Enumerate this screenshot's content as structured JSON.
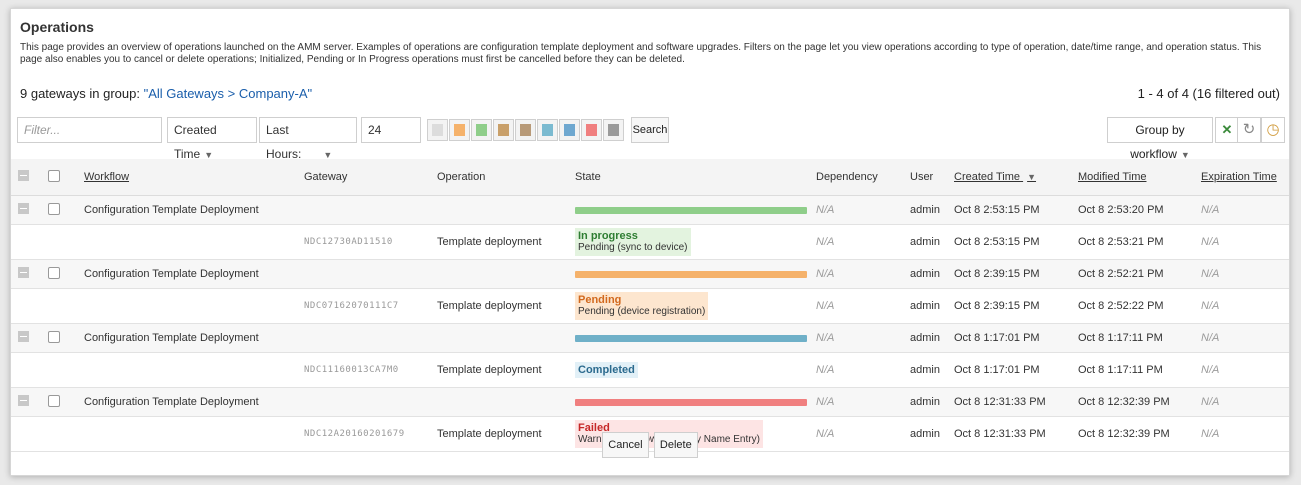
{
  "page": {
    "title": "Operations",
    "description": "This page provides an overview of operations launched on the AMM server. Examples of operations are configuration template deployment and software upgrades. Filters on the page let you view operations according to type of operation, date/time range, and operation status. This page also enables you to cancel or delete operations; Initialized, Pending or In Progress operations must first be cancelled before they can be deleted.",
    "group_prefix": "9 gateways in group: ",
    "group_link": "\"All Gateways > Company-A\"",
    "count": "1 - 4 of 4 (16 filtered out)"
  },
  "toolbar": {
    "filter_placeholder": "Filter...",
    "time_field": "Created Time",
    "range": "Last Hours:",
    "hours": "24",
    "search": "Search",
    "group_by": "Group by workflow"
  },
  "status_chips": [
    "#dcdcdc",
    "#f5b26b",
    "#8fce8a",
    "#c9a06a",
    "#b89a78",
    "#7bbad0",
    "#6fa8d0",
    "#f07f7f",
    "#9a9a9a"
  ],
  "columns": {
    "workflow": "Workflow",
    "gateway": "Gateway",
    "operation": "Operation",
    "state": "State",
    "dependency": "Dependency",
    "user": "User",
    "created": "Created Time",
    "modified": "Modified Time",
    "expiration": "Expiration Time"
  },
  "groups": [
    {
      "workflow": "Configuration Template Deployment",
      "bar_color": "#8fce8a",
      "dependency": "N/A",
      "user": "admin",
      "created": "Oct 8 2:53:15 PM",
      "modified": "Oct 8 2:53:20 PM",
      "expiration": "N/A",
      "child": {
        "gateway": "NDC12730AD11510",
        "operation": "Template deployment",
        "state_title": "In progress",
        "state_detail": "Pending (sync to device)",
        "state_bg": "#e3f3df",
        "state_color": "#2e7d32",
        "dependency": "N/A",
        "user": "admin",
        "created": "Oct 8 2:53:15 PM",
        "modified": "Oct 8 2:53:21 PM",
        "expiration": "N/A"
      }
    },
    {
      "workflow": "Configuration Template Deployment",
      "bar_color": "#f5b26b",
      "dependency": "N/A",
      "user": "admin",
      "created": "Oct 8 2:39:15 PM",
      "modified": "Oct 8 2:52:21 PM",
      "expiration": "N/A",
      "child": {
        "gateway": "NDC07162070111C7",
        "operation": "Template deployment",
        "state_title": "Pending",
        "state_detail": "Pending (device registration)",
        "state_bg": "#fde6cf",
        "state_color": "#d2691e",
        "dependency": "N/A",
        "user": "admin",
        "created": "Oct 8 2:39:15 PM",
        "modified": "Oct 8 2:52:22 PM",
        "expiration": "N/A"
      }
    },
    {
      "workflow": "Configuration Template Deployment",
      "bar_color": "#6fb0c8",
      "dependency": "N/A",
      "user": "admin",
      "created": "Oct 8 1:17:01 PM",
      "modified": "Oct 8 1:17:11 PM",
      "expiration": "N/A",
      "child": {
        "gateway": "NDC11160013CA7M0",
        "operation": "Template deployment",
        "state_title": "Completed",
        "state_detail": "",
        "state_bg": "#e2f0f7",
        "state_color": "#2b6a8e",
        "dependency": "N/A",
        "user": "admin",
        "created": "Oct 8 1:17:01 PM",
        "modified": "Oct 8 1:17:11 PM",
        "expiration": "N/A"
      }
    },
    {
      "workflow": "Configuration Template Deployment",
      "bar_color": "#f07f7f",
      "dependency": "N/A",
      "user": "admin",
      "created": "Oct 8 12:31:33 PM",
      "modified": "Oct 8 12:32:39 PM",
      "expiration": "N/A",
      "child": {
        "gateway": "NDC12A20160201679",
        "operation": "Template deployment",
        "state_title": "Failed",
        "state_detail": "Warning (Unknown Friendly Name Entry)",
        "state_bg": "#fde4e4",
        "state_color": "#c62828",
        "dependency": "N/A",
        "user": "admin",
        "created": "Oct 8 12:31:33 PM",
        "modified": "Oct 8 12:32:39 PM",
        "expiration": "N/A"
      }
    }
  ],
  "footer": {
    "cancel": "Cancel",
    "delete": "Delete"
  }
}
